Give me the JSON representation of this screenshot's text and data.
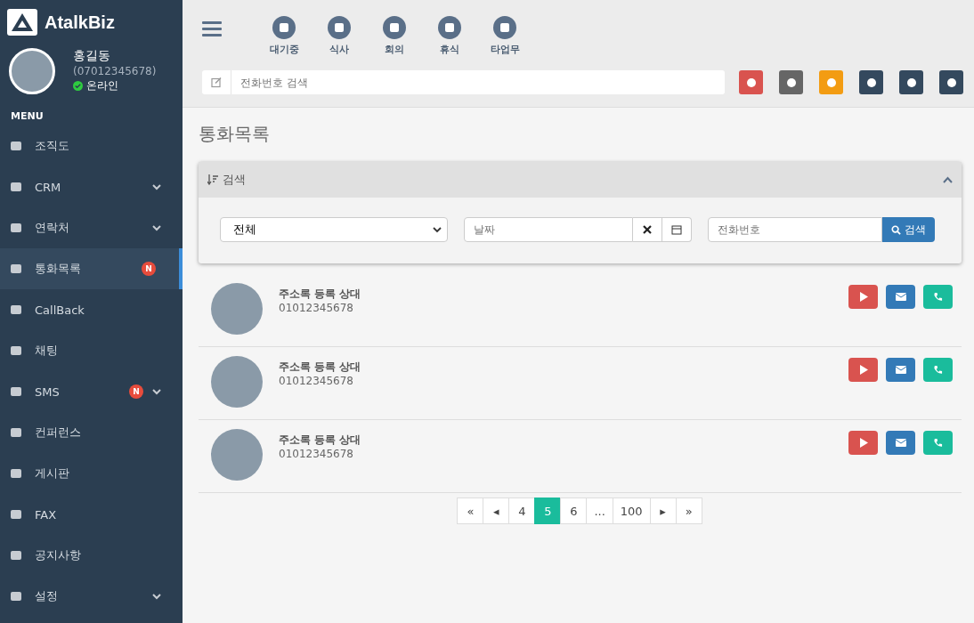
{
  "brand": {
    "name": "AtalkBiz"
  },
  "profile": {
    "name": "홍길동",
    "phone": "(07012345678)",
    "status": "온라인",
    "online": true
  },
  "menu": {
    "heading": "MENU",
    "items": [
      {
        "label": "조직도",
        "caret": false,
        "selected": false
      },
      {
        "label": "CRM",
        "caret": true,
        "selected": false
      },
      {
        "label": "연락처",
        "caret": true,
        "selected": false
      },
      {
        "label": "통화목록",
        "badge": "N",
        "caret": false,
        "selected": true
      },
      {
        "label": "CallBack",
        "caret": false,
        "selected": false
      },
      {
        "label": "채팅",
        "caret": false,
        "selected": false
      },
      {
        "label": "SMS",
        "badge": "N",
        "caret": true,
        "selected": false
      },
      {
        "label": "컨퍼런스",
        "caret": false,
        "selected": false
      },
      {
        "label": "게시판",
        "caret": false,
        "selected": false
      },
      {
        "label": "FAX",
        "caret": false,
        "selected": false
      },
      {
        "label": "공지사항",
        "caret": false,
        "selected": false
      },
      {
        "label": "설정",
        "caret": true,
        "selected": false
      }
    ]
  },
  "status_buttons": [
    "대기중",
    "식사",
    "회의",
    "휴식",
    "타업무"
  ],
  "phone_search": {
    "placeholder": "전화번호 검색"
  },
  "page_title": "통화목록",
  "search_panel": {
    "title": "검색",
    "expanded": true,
    "filter": "전체",
    "date_placeholder": "날짜",
    "phone_placeholder": "전화번호",
    "button": "검색"
  },
  "calls": [
    {
      "name": "주소록 등록 상대",
      "number": "01012345678"
    },
    {
      "name": "주소록 등록 상대",
      "number": "01012345678"
    },
    {
      "name": "주소록 등록 상대",
      "number": "01012345678"
    }
  ],
  "pagination": [
    {
      "label": "«",
      "selected": false
    },
    {
      "label": "◂",
      "selected": false
    },
    {
      "label": "4",
      "selected": false
    },
    {
      "label": "5",
      "selected": true
    },
    {
      "label": "6",
      "selected": false
    },
    {
      "label": "...",
      "selected": false
    },
    {
      "label": "100",
      "selected": false
    },
    {
      "label": "▸",
      "selected": false
    },
    {
      "label": "»",
      "selected": false
    }
  ]
}
